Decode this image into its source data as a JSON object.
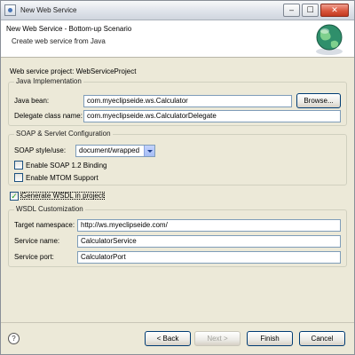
{
  "window": {
    "title": "New Web Service",
    "controls": {
      "minimize": "–",
      "maximize": "☐",
      "close": "✕"
    }
  },
  "banner": {
    "title": "New Web Service - Bottom-up Scenario",
    "description": "Create web service from Java",
    "graphic": "globe-wizard-icon"
  },
  "project": {
    "label": "Web service project:",
    "value": "WebServiceProject"
  },
  "java_impl": {
    "group_title": "Java Implementation",
    "java_bean_label": "Java bean:",
    "java_bean_value": "com.myeclipseide.ws.Calculator",
    "browse_label": "Browse...",
    "delegate_label": "Delegate class name:",
    "delegate_value": "com.myeclipseide.ws.CalculatorDelegate"
  },
  "soap": {
    "group_title": "SOAP & Servlet Configuration",
    "style_label": "SOAP style/use:",
    "style_value": "document/wrapped",
    "soap12_label": "Enable SOAP 1.2 Binding",
    "soap12_checked": false,
    "mtom_label": "Enable MTOM Support",
    "mtom_checked": false
  },
  "wsdl": {
    "generate_label": "Generate WSDL in project",
    "generate_checked": true,
    "group_title": "WSDL Customization",
    "namespace_label": "Target namespace:",
    "namespace_value": "http://ws.myeclipseide.com/",
    "service_name_label": "Service name:",
    "service_name_value": "CalculatorService",
    "service_port_label": "Service port:",
    "service_port_value": "CalculatorPort"
  },
  "footer": {
    "help_glyph": "?",
    "back_label": "< Back",
    "next_label": "Next >",
    "finish_label": "Finish",
    "cancel_label": "Cancel"
  },
  "colors": {
    "accent": "#003c74",
    "check": "#21a121",
    "panel": "#ece9d8"
  }
}
